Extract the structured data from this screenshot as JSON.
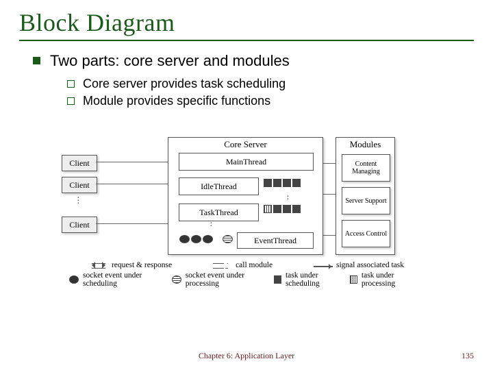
{
  "title": "Block Diagram",
  "bullets": {
    "l1": "Two parts: core server and modules",
    "l2a": "Core server provides task scheduling",
    "l2b": "Module provides specific functions"
  },
  "diagram": {
    "clients": [
      "Client",
      "Client",
      "Client"
    ],
    "core": {
      "label": "Core Server",
      "main": "MainThread",
      "idle": "IdleThread",
      "task": "TaskThread",
      "event": "EventThread"
    },
    "modules": {
      "label": "Modules",
      "items": [
        "Content Managing",
        "Server Support",
        "Access Control"
      ]
    },
    "legend": {
      "req": "request & response",
      "call": "call module",
      "signal": "signal associated task",
      "se_sched": "socket event under scheduling",
      "se_proc": "socket event under processing",
      "task_sched": "task under scheduling",
      "task_proc": "task under processing"
    }
  },
  "footer": {
    "center": "Chapter 6: Application Layer",
    "page": "135"
  }
}
